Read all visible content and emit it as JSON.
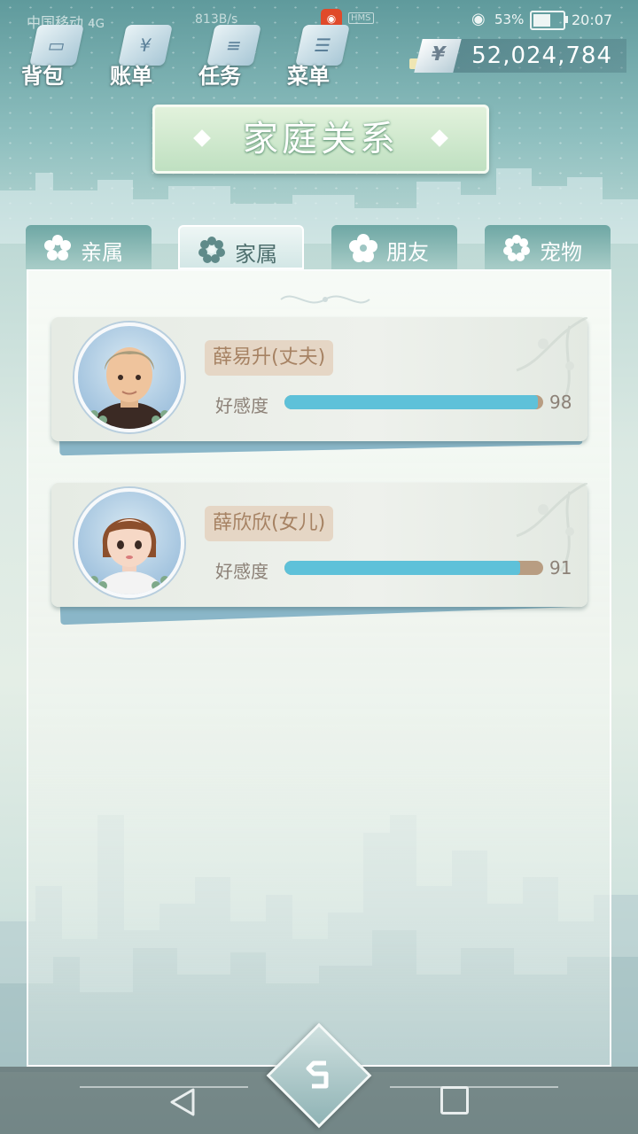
{
  "status_bar": {
    "carrier": "中国移动",
    "network": "4G",
    "speed": "813B/s",
    "notification_badge": "HMS",
    "battery_percent": "53%",
    "time": "20:07"
  },
  "top_nav": {
    "items": [
      {
        "label": "背包",
        "icon": "bag-icon"
      },
      {
        "label": "账单",
        "icon": "bill-icon"
      },
      {
        "label": "任务",
        "icon": "task-icon"
      },
      {
        "label": "菜单",
        "icon": "menu-icon"
      }
    ]
  },
  "currency": {
    "symbol": "¥",
    "value": "52,024,784"
  },
  "title": "家庭关系",
  "tabs": [
    {
      "label": "亲属",
      "active": false
    },
    {
      "label": "家属",
      "active": true
    },
    {
      "label": "朋友",
      "active": false
    },
    {
      "label": "宠物",
      "active": false
    }
  ],
  "relations": [
    {
      "name": "薛易升(丈夫)",
      "affection_label": "好感度",
      "affection": 98,
      "affection_max": 100,
      "avatar": "husband-avatar"
    },
    {
      "name": "薛欣欣(女儿)",
      "affection_label": "好感度",
      "affection": 91,
      "affection_max": 100,
      "avatar": "daughter-avatar"
    }
  ],
  "colors": {
    "affection_bar": "#5ec1d9",
    "affection_track": "#b89d82",
    "name_tag_bg": "#e5d6c5",
    "title_bg": "#c9e6c8"
  }
}
